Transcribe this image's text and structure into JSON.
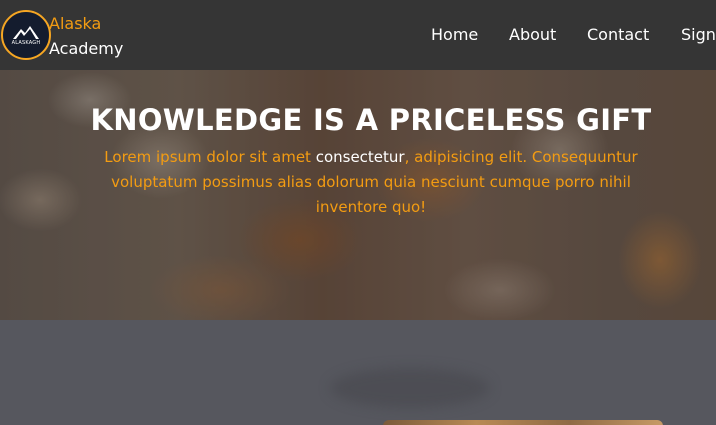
{
  "brand": {
    "logo_text": "ALASKAGH",
    "name_line1": "Alaska",
    "name_line2": "Academy"
  },
  "nav": {
    "links": [
      "Home",
      "About",
      "Contact",
      "Sign"
    ]
  },
  "hero": {
    "title": "KNOWLEDGE IS A PRICELESS GIFT",
    "text_part1": "Lorem ipsum dolor sit amet ",
    "text_highlight": "consectetur",
    "text_part2": ", adipisicing elit. Consequuntur voluptatum possimus alias dolorum quia nesciunt cumque porro nihil inventore quo!"
  },
  "colors": {
    "accent": "#f39c12",
    "navbar": "#353535",
    "section_bg": "#56575e"
  }
}
